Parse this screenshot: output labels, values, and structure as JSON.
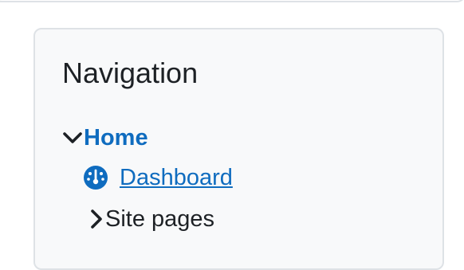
{
  "navigation": {
    "title": "Navigation",
    "items": [
      {
        "label": "Home",
        "expanded": true,
        "icon": "chevron-down-icon"
      },
      {
        "label": "Dashboard",
        "icon": "dashboard-gauge-icon"
      },
      {
        "label": "Site pages",
        "expanded": false,
        "icon": "chevron-right-icon"
      }
    ]
  },
  "colors": {
    "link": "#0f6cbf",
    "text": "#1d2125",
    "block_background": "#f8f9fa",
    "border": "#dee2e6"
  }
}
